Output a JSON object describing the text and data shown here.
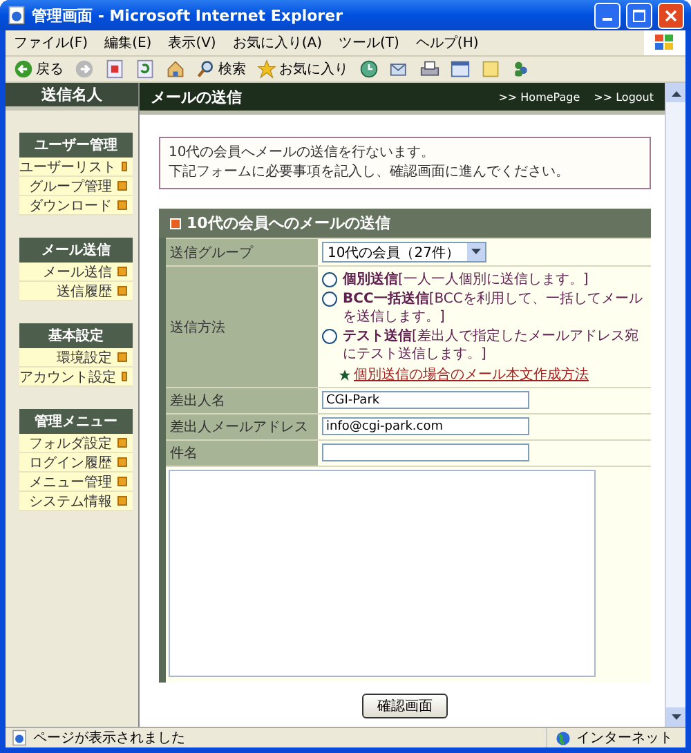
{
  "window": {
    "title": "管理画面 - Microsoft Internet Explorer"
  },
  "menu_bar": [
    "ファイル(F)",
    "編集(E)",
    "表示(V)",
    "お気に入り(A)",
    "ツール(T)",
    "ヘルプ(H)"
  ],
  "toolbar": [
    {
      "kind": "back",
      "label": "戻る"
    },
    {
      "kind": "forward"
    },
    {
      "kind": "stop"
    },
    {
      "kind": "refresh"
    },
    {
      "kind": "home"
    },
    {
      "kind": "search",
      "label": "検索"
    },
    {
      "kind": "favorites",
      "label": "お気に入り"
    },
    {
      "kind": "history"
    },
    {
      "kind": "mail"
    },
    {
      "kind": "print"
    },
    {
      "kind": "edit"
    },
    {
      "kind": "notes"
    },
    {
      "kind": "messenger"
    }
  ],
  "sidebar": {
    "title": "送信名人",
    "sections": [
      {
        "title": "ユーザー管理",
        "items": [
          "ユーザーリスト",
          "グループ管理",
          "ダウンロード"
        ]
      },
      {
        "title": "メール送信",
        "items": [
          "メール送信",
          "送信履歴"
        ]
      },
      {
        "title": "基本設定",
        "items": [
          "環境設定",
          "アカウント設定"
        ]
      },
      {
        "title": "管理メニュー",
        "items": [
          "フォルダ設定",
          "ログイン履歴",
          "メニュー管理",
          "システム情報"
        ]
      }
    ]
  },
  "header": {
    "title": "メールの送信",
    "links": [
      ">> HomePage",
      ">> Logout"
    ]
  },
  "notice": [
    "10代の会員へメールの送信を行ないます。",
    "下記フォームに必要事項を記入し、確認画面に進んでください。"
  ],
  "form": {
    "title": "10代の会員へのメールの送信",
    "group": {
      "label": "送信グループ",
      "value": "10代の会員（27件）"
    },
    "method": {
      "label": "送信方法",
      "options": [
        {
          "name": "個別送信",
          "note": "[一人一人個別に送信します。]",
          "selected": false
        },
        {
          "name": "BCC一括送信",
          "note": "[BCCを利用して、一括してメールを送信します。]",
          "selected": false
        },
        {
          "name": "テスト送信",
          "note": "[差出人で指定したメールアドレス宛にテスト送信します。]",
          "selected": false
        }
      ],
      "help_link": "個別送信の場合のメール本文作成方法"
    },
    "sender_name": {
      "label": "差出人名",
      "value": "CGI-Park"
    },
    "sender_email": {
      "label": "差出人メールアドレス",
      "value": "info@cgi-park.com"
    },
    "subject": {
      "label": "件名"
    },
    "submit": "確認画面"
  },
  "status_bar": {
    "text": "ページが表示されました",
    "zone": "インターネット"
  }
}
